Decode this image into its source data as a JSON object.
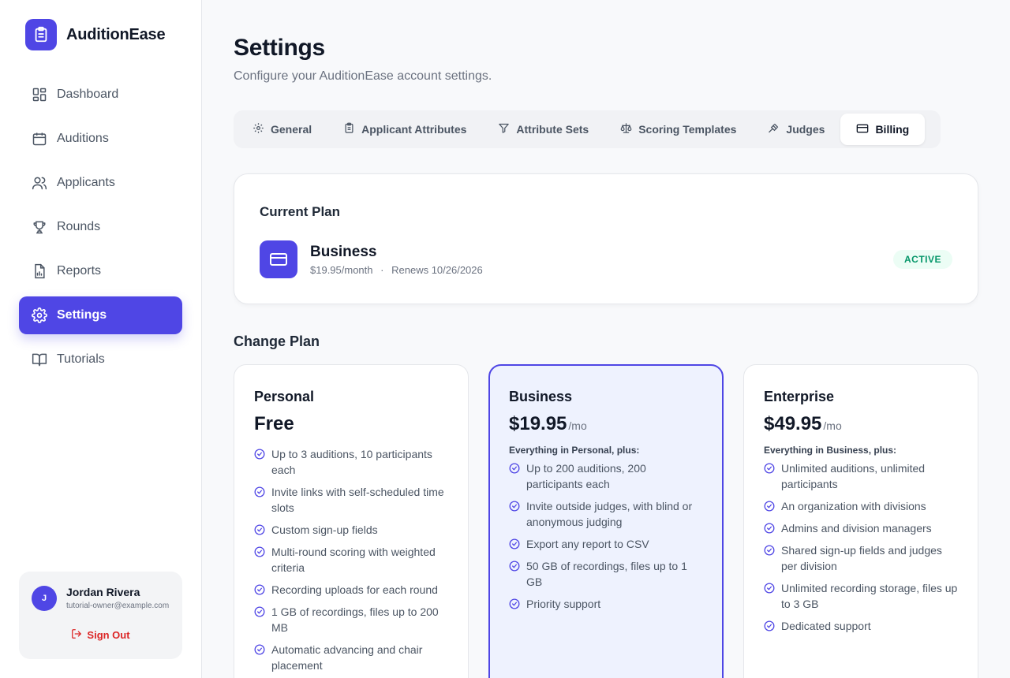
{
  "app": {
    "name": "AuditionEase"
  },
  "sidebar": {
    "items": [
      {
        "label": "Dashboard",
        "icon": "dashboard-icon"
      },
      {
        "label": "Auditions",
        "icon": "calendar-icon"
      },
      {
        "label": "Applicants",
        "icon": "users-icon"
      },
      {
        "label": "Rounds",
        "icon": "trophy-icon"
      },
      {
        "label": "Reports",
        "icon": "report-icon"
      },
      {
        "label": "Settings",
        "icon": "gear-icon",
        "active": true
      },
      {
        "label": "Tutorials",
        "icon": "book-icon"
      }
    ]
  },
  "user": {
    "initial": "J",
    "name": "Jordan Rivera",
    "email": "tutorial-owner@example.com",
    "signout_label": "Sign Out"
  },
  "page": {
    "title": "Settings",
    "subtitle": "Configure your AuditionEase account settings."
  },
  "tabs": [
    {
      "label": "General",
      "icon": "gear-icon"
    },
    {
      "label": "Applicant Attributes",
      "icon": "clipboard-icon"
    },
    {
      "label": "Attribute Sets",
      "icon": "filter-icon"
    },
    {
      "label": "Scoring Templates",
      "icon": "scale-icon"
    },
    {
      "label": "Judges",
      "icon": "gavel-icon"
    },
    {
      "label": "Billing",
      "icon": "credit-card-icon",
      "active": true
    }
  ],
  "current_plan": {
    "heading": "Current Plan",
    "name": "Business",
    "price": "$19.95/month",
    "separator": "·",
    "renews": "Renews 10/26/2026",
    "status": "ACTIVE"
  },
  "change_plan": {
    "heading": "Change Plan",
    "plans": [
      {
        "name": "Personal",
        "price": "Free",
        "period": "",
        "lead": "",
        "features": [
          "Up to 3 auditions, 10 participants each",
          "Invite links with self-scheduled time slots",
          "Custom sign-up fields",
          "Multi-round scoring with weighted criteria",
          "Recording uploads for each round",
          "1 GB of recordings, files up to 200 MB",
          "Automatic advancing and chair placement"
        ]
      },
      {
        "name": "Business",
        "price": "$19.95",
        "period": "/mo",
        "lead": "Everything in Personal, plus:",
        "selected": true,
        "features": [
          "Up to 200 auditions, 200 participants each",
          "Invite outside judges, with blind or anonymous judging",
          "Export any report to CSV",
          "50 GB of recordings, files up to 1 GB",
          "Priority support"
        ]
      },
      {
        "name": "Enterprise",
        "price": "$49.95",
        "period": "/mo",
        "lead": "Everything in Business, plus:",
        "features": [
          "Unlimited auditions, unlimited participants",
          "An organization with divisions",
          "Admins and division managers",
          "Shared sign-up fields and judges per division",
          "Unlimited recording storage, files up to 3 GB",
          "Dedicated support"
        ]
      }
    ]
  },
  "colors": {
    "accent": "#4f46e5",
    "active_badge_bg": "#ecfdf5",
    "active_badge_text": "#059669",
    "signout": "#dc2626"
  }
}
